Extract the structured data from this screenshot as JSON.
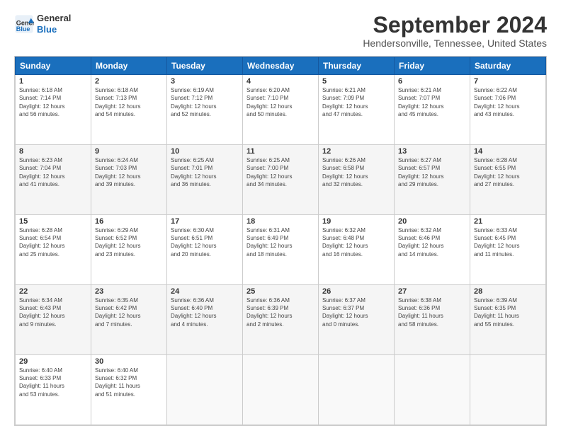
{
  "logo": {
    "line1": "General",
    "line2": "Blue"
  },
  "title": "September 2024",
  "subtitle": "Hendersonville, Tennessee, United States",
  "weekdays": [
    "Sunday",
    "Monday",
    "Tuesday",
    "Wednesday",
    "Thursday",
    "Friday",
    "Saturday"
  ],
  "weeks": [
    [
      {
        "day": "1",
        "info": "Sunrise: 6:18 AM\nSunset: 7:14 PM\nDaylight: 12 hours\nand 56 minutes."
      },
      {
        "day": "2",
        "info": "Sunrise: 6:18 AM\nSunset: 7:13 PM\nDaylight: 12 hours\nand 54 minutes."
      },
      {
        "day": "3",
        "info": "Sunrise: 6:19 AM\nSunset: 7:12 PM\nDaylight: 12 hours\nand 52 minutes."
      },
      {
        "day": "4",
        "info": "Sunrise: 6:20 AM\nSunset: 7:10 PM\nDaylight: 12 hours\nand 50 minutes."
      },
      {
        "day": "5",
        "info": "Sunrise: 6:21 AM\nSunset: 7:09 PM\nDaylight: 12 hours\nand 47 minutes."
      },
      {
        "day": "6",
        "info": "Sunrise: 6:21 AM\nSunset: 7:07 PM\nDaylight: 12 hours\nand 45 minutes."
      },
      {
        "day": "7",
        "info": "Sunrise: 6:22 AM\nSunset: 7:06 PM\nDaylight: 12 hours\nand 43 minutes."
      }
    ],
    [
      {
        "day": "8",
        "info": "Sunrise: 6:23 AM\nSunset: 7:04 PM\nDaylight: 12 hours\nand 41 minutes."
      },
      {
        "day": "9",
        "info": "Sunrise: 6:24 AM\nSunset: 7:03 PM\nDaylight: 12 hours\nand 39 minutes."
      },
      {
        "day": "10",
        "info": "Sunrise: 6:25 AM\nSunset: 7:01 PM\nDaylight: 12 hours\nand 36 minutes."
      },
      {
        "day": "11",
        "info": "Sunrise: 6:25 AM\nSunset: 7:00 PM\nDaylight: 12 hours\nand 34 minutes."
      },
      {
        "day": "12",
        "info": "Sunrise: 6:26 AM\nSunset: 6:58 PM\nDaylight: 12 hours\nand 32 minutes."
      },
      {
        "day": "13",
        "info": "Sunrise: 6:27 AM\nSunset: 6:57 PM\nDaylight: 12 hours\nand 29 minutes."
      },
      {
        "day": "14",
        "info": "Sunrise: 6:28 AM\nSunset: 6:55 PM\nDaylight: 12 hours\nand 27 minutes."
      }
    ],
    [
      {
        "day": "15",
        "info": "Sunrise: 6:28 AM\nSunset: 6:54 PM\nDaylight: 12 hours\nand 25 minutes."
      },
      {
        "day": "16",
        "info": "Sunrise: 6:29 AM\nSunset: 6:52 PM\nDaylight: 12 hours\nand 23 minutes."
      },
      {
        "day": "17",
        "info": "Sunrise: 6:30 AM\nSunset: 6:51 PM\nDaylight: 12 hours\nand 20 minutes."
      },
      {
        "day": "18",
        "info": "Sunrise: 6:31 AM\nSunset: 6:49 PM\nDaylight: 12 hours\nand 18 minutes."
      },
      {
        "day": "19",
        "info": "Sunrise: 6:32 AM\nSunset: 6:48 PM\nDaylight: 12 hours\nand 16 minutes."
      },
      {
        "day": "20",
        "info": "Sunrise: 6:32 AM\nSunset: 6:46 PM\nDaylight: 12 hours\nand 14 minutes."
      },
      {
        "day": "21",
        "info": "Sunrise: 6:33 AM\nSunset: 6:45 PM\nDaylight: 12 hours\nand 11 minutes."
      }
    ],
    [
      {
        "day": "22",
        "info": "Sunrise: 6:34 AM\nSunset: 6:43 PM\nDaylight: 12 hours\nand 9 minutes."
      },
      {
        "day": "23",
        "info": "Sunrise: 6:35 AM\nSunset: 6:42 PM\nDaylight: 12 hours\nand 7 minutes."
      },
      {
        "day": "24",
        "info": "Sunrise: 6:36 AM\nSunset: 6:40 PM\nDaylight: 12 hours\nand 4 minutes."
      },
      {
        "day": "25",
        "info": "Sunrise: 6:36 AM\nSunset: 6:39 PM\nDaylight: 12 hours\nand 2 minutes."
      },
      {
        "day": "26",
        "info": "Sunrise: 6:37 AM\nSunset: 6:37 PM\nDaylight: 12 hours\nand 0 minutes."
      },
      {
        "day": "27",
        "info": "Sunrise: 6:38 AM\nSunset: 6:36 PM\nDaylight: 11 hours\nand 58 minutes."
      },
      {
        "day": "28",
        "info": "Sunrise: 6:39 AM\nSunset: 6:35 PM\nDaylight: 11 hours\nand 55 minutes."
      }
    ],
    [
      {
        "day": "29",
        "info": "Sunrise: 6:40 AM\nSunset: 6:33 PM\nDaylight: 11 hours\nand 53 minutes."
      },
      {
        "day": "30",
        "info": "Sunrise: 6:40 AM\nSunset: 6:32 PM\nDaylight: 11 hours\nand 51 minutes."
      },
      {
        "day": "",
        "info": ""
      },
      {
        "day": "",
        "info": ""
      },
      {
        "day": "",
        "info": ""
      },
      {
        "day": "",
        "info": ""
      },
      {
        "day": "",
        "info": ""
      }
    ]
  ]
}
